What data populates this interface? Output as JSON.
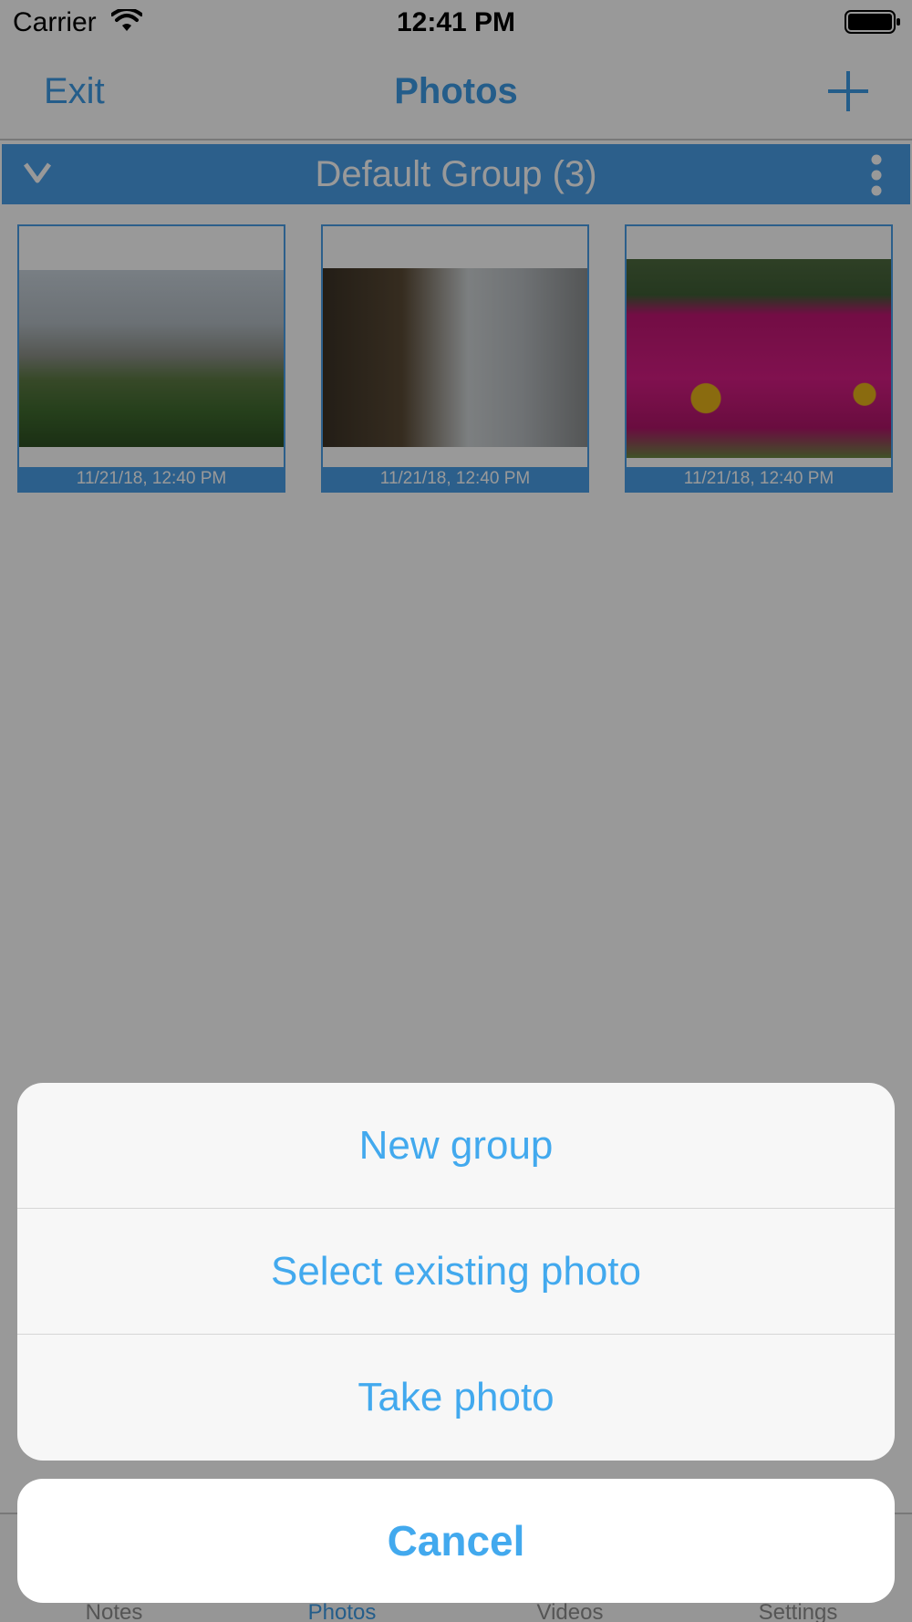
{
  "status_bar": {
    "carrier": "Carrier",
    "time": "12:41 PM"
  },
  "nav": {
    "exit_label": "Exit",
    "title": "Photos",
    "add_icon": "plus-icon"
  },
  "group": {
    "title": "Default Group (3)",
    "collapse_icon": "chevron-down-icon",
    "more_icon": "more-vertical-icon"
  },
  "photos": [
    {
      "caption": "11/21/18, 12:40 PM",
      "subject": "beach plants"
    },
    {
      "caption": "11/21/18, 12:40 PM",
      "subject": "waterfall"
    },
    {
      "caption": "11/21/18, 12:40 PM",
      "subject": "pink flowers"
    }
  ],
  "tabs": [
    {
      "label": "Notes",
      "active": false
    },
    {
      "label": "Photos",
      "active": true
    },
    {
      "label": "Videos",
      "active": false
    },
    {
      "label": "Settings",
      "active": false
    }
  ],
  "action_sheet": {
    "items": [
      "New group",
      "Select existing photo",
      "Take photo"
    ],
    "cancel": "Cancel"
  },
  "colors": {
    "accent": "#3c9be6",
    "group_header": "#4a9ee8",
    "action_text": "#42a9ee"
  }
}
